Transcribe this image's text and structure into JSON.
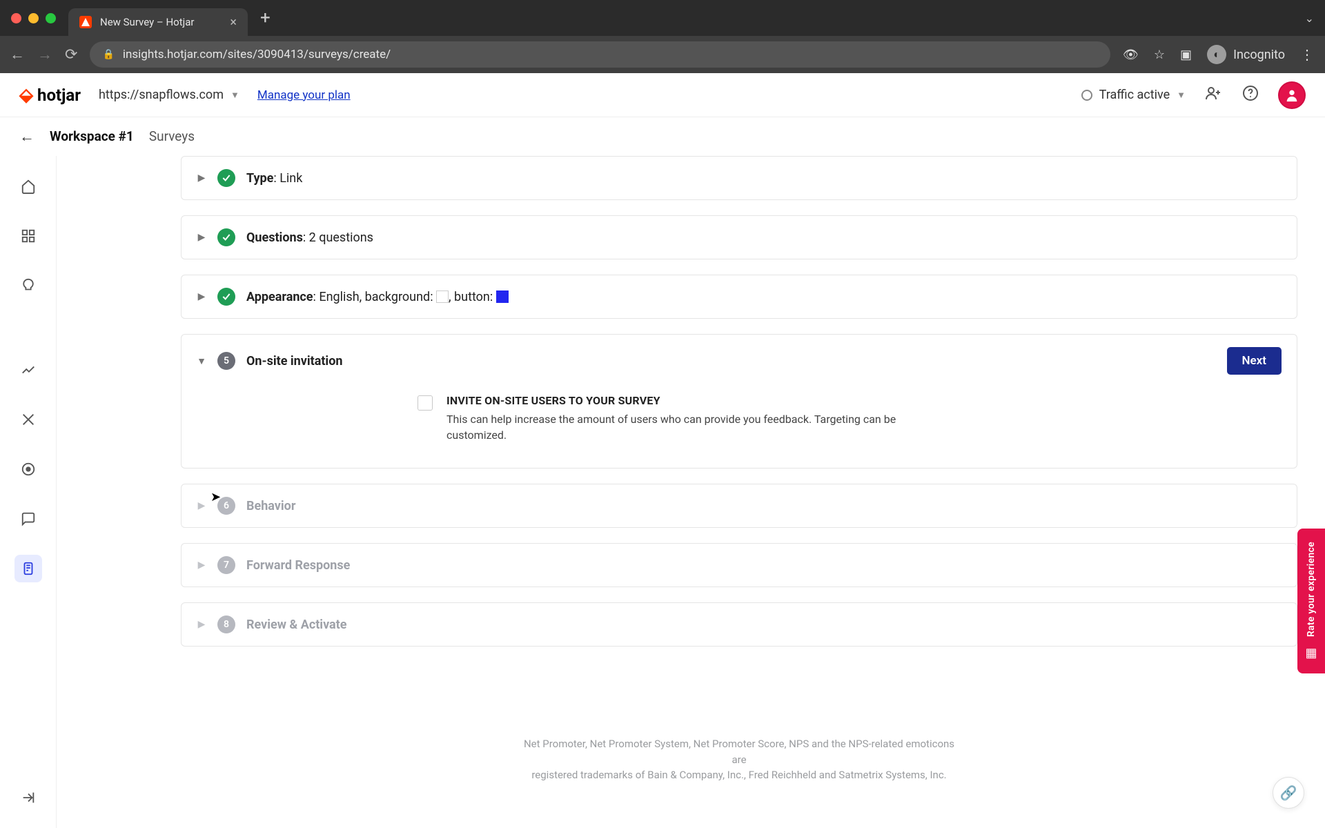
{
  "browser": {
    "tab_title": "New Survey – Hotjar",
    "url": "insights.hotjar.com/sites/3090413/surveys/create/",
    "incognito_label": "Incognito"
  },
  "header": {
    "logo_text": "hotjar",
    "site_selector": "https://snapflows.com",
    "plan_link": "Manage your plan",
    "traffic_label": "Traffic active"
  },
  "breadcrumb": {
    "workspace": "Workspace #1",
    "section": "Surveys"
  },
  "steps": {
    "type": {
      "label": "Type",
      "value": ": Link"
    },
    "questions": {
      "label": "Questions",
      "value": ": 2 questions"
    },
    "appearance": {
      "label": "Appearance",
      "value_pre": ": English, background: ",
      "value_mid": ", button: "
    },
    "invitation": {
      "number": "5",
      "title": "On-site invitation",
      "next_btn": "Next",
      "invite_heading": "INVITE ON-SITE USERS TO YOUR SURVEY",
      "invite_body": "This can help increase the amount of users who can provide you feedback. Targeting can be customized."
    },
    "behavior": {
      "number": "6",
      "title": "Behavior"
    },
    "forward": {
      "number": "7",
      "title": "Forward Response"
    },
    "review": {
      "number": "8",
      "title": "Review & Activate"
    }
  },
  "footer": {
    "line1": "Net Promoter, Net Promoter System, Net Promoter Score, NPS and the NPS-related emoticons are",
    "line2": "registered trademarks of Bain & Company, Inc., Fred Reichheld and Satmetrix Systems, Inc."
  },
  "feedback_tab": "Rate your experience",
  "colors": {
    "swatch_bg": "#ffffff",
    "swatch_btn": "#2226ef"
  }
}
